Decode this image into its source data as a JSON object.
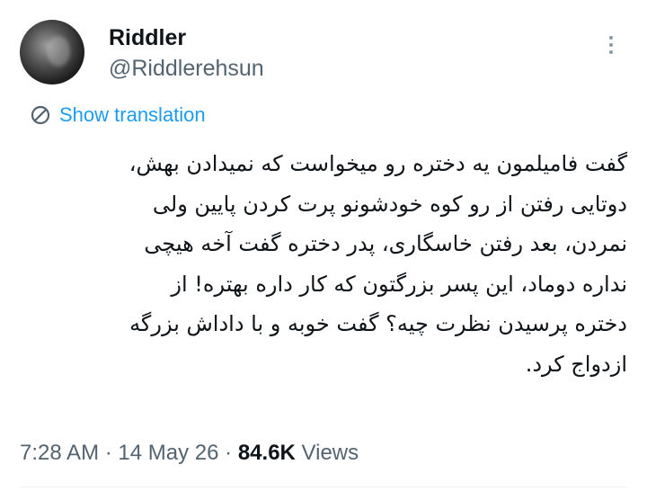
{
  "author": {
    "display_name": "Riddler",
    "handle": "@Riddlerehsun"
  },
  "translate_label": "Show translation",
  "tweet_lines": [
    "گفت فامیلمون یه دختره رو میخواست که نمیدادن بهش،",
    "دوتایی رفتن از رو کوه خودشونو پرت کردن پایین ولی",
    "نمردن، بعد رفتن خاسگاری، پدر دختره گفت آخه هیچی",
    "نداره دوماد، این پسر بزرگتون که کار داره بهتره! از",
    "دختره پرسیدن نظرت چیه؟ گفت خوبه و با داداش بزرگه",
    "ازدواج کرد."
  ],
  "meta": {
    "time": "7:28 AM",
    "separator1": "·",
    "date": "14 May 26",
    "separator2": "·",
    "views_count": "84.6K",
    "views_label": "Views"
  },
  "icons": {
    "more": "more-vertical-icon",
    "translate": "translate-icon"
  },
  "colors": {
    "link": "#1d9bf0",
    "secondary_text": "#536471",
    "primary_text": "#0f1419"
  }
}
